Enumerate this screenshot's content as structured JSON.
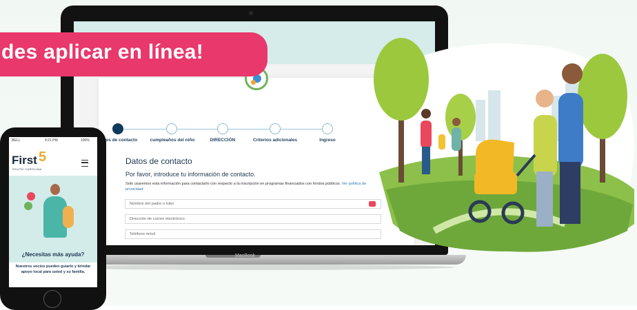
{
  "banner": {
    "text": "des aplicar en línea!"
  },
  "laptop": {
    "brand": "MacBook",
    "steps": [
      {
        "label": "Datos de contacto",
        "active": true
      },
      {
        "label": "cumpleaños del niño",
        "active": false
      },
      {
        "label": "DIRECCIÓN",
        "active": false
      },
      {
        "label": "Criterios adicionales",
        "active": false
      },
      {
        "label": "Ingreso",
        "active": false
      }
    ],
    "form": {
      "title": "Datos de contacto",
      "subtitle": "Por favor, introduce tu información de contacto.",
      "note": "Solo usaremos esta información para contactarlo con respecto a la inscripción en programas financiados con fondos públicos.",
      "note_link": "Ver política de privacidad",
      "fields": [
        {
          "placeholder": "Nombre del padre o tutor"
        },
        {
          "placeholder": "Dirección de correo electrónico"
        },
        {
          "placeholder": "Teléfono móvil"
        }
      ]
    }
  },
  "phone": {
    "status_left": "BELL",
    "status_time": "4:21 PM",
    "status_right": "100%",
    "logo": "First",
    "logo_five": "5",
    "logo_sub": "SOUTH CAROLINA",
    "heading": "¿Necesitas más ayuda?",
    "body": "Nuestros socios pueden guiarlo y brindar apoyo local para usted y su familia."
  },
  "colors": {
    "banner": "#e8386c",
    "accent_navy": "#0e3a5c",
    "link": "#2a78b5",
    "mint": "#d3ecea",
    "grass": "#8cc04a"
  },
  "illustration": {
    "subject": "family-walking-in-park-with-stroller"
  }
}
